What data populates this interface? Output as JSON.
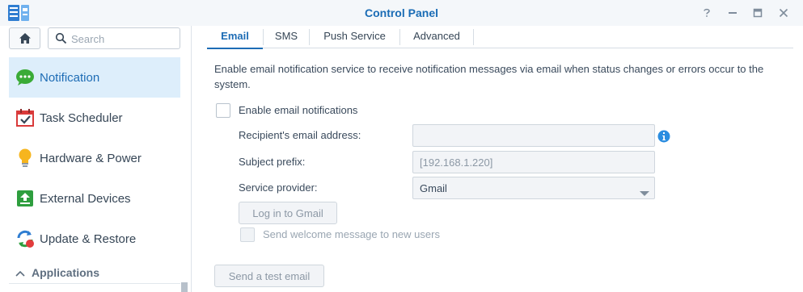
{
  "window": {
    "title": "Control Panel",
    "logo_icon": "control-panel-icon",
    "controls": [
      "help-icon",
      "minimize-icon",
      "maximize-icon",
      "close-icon"
    ]
  },
  "sidebar": {
    "search": {
      "placeholder": "Search",
      "value": ""
    },
    "items": [
      {
        "label": "Notification",
        "icon": "chat-bubble-icon",
        "active": true
      },
      {
        "label": "Task Scheduler",
        "icon": "calendar-check-icon",
        "active": false
      },
      {
        "label": "Hardware & Power",
        "icon": "lightbulb-icon",
        "active": false
      },
      {
        "label": "External Devices",
        "icon": "upload-arrow-icon",
        "active": false
      },
      {
        "label": "Update & Restore",
        "icon": "refresh-icon",
        "active": false
      }
    ],
    "section": {
      "label": "Applications",
      "icon": "chevron-up-icon"
    }
  },
  "tabs": [
    {
      "label": "Email",
      "active": true
    },
    {
      "label": "SMS",
      "active": false
    },
    {
      "label": "Push Service",
      "active": false
    },
    {
      "label": "Advanced",
      "active": false
    }
  ],
  "email": {
    "description": "Enable email notification service to receive notification messages via email when status changes or errors occur to the system.",
    "enable_label": "Enable email notifications",
    "enable_checked": false,
    "recipient_label": "Recipient's email address:",
    "recipient_value": "",
    "subject_label": "Subject prefix:",
    "subject_value": "[192.168.1.220]",
    "provider_label": "Service provider:",
    "provider_value": "Gmail",
    "login_button": "Log in to Gmail",
    "welcome_label": "Send welcome message to new users",
    "welcome_checked": false,
    "test_button": "Send a test email"
  },
  "colors": {
    "accent": "#1d6cb5",
    "active_bg": "#ddeefb",
    "info": "#2b8de0"
  }
}
